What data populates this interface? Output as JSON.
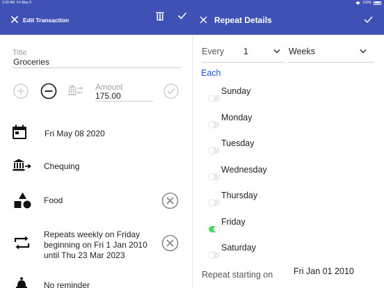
{
  "status_bar": {
    "time": "2:09 AM",
    "date": "Fri May 8",
    "battery": "100%"
  },
  "edit_panel": {
    "title": "Edit Transaction",
    "title_field": {
      "label": "Title",
      "value": "Groceries"
    },
    "amount_field": {
      "label": "Amount",
      "value": "175.00"
    },
    "date": "Fri May 08 2020",
    "account": "Chequing",
    "category": "Food",
    "repeat": [
      "Repeats weekly on Friday",
      "beginning on Fri 1 Jan 2010",
      "until Thu 23 Mar 2023"
    ],
    "reminder": "No reminder"
  },
  "repeat_panel": {
    "title": "Repeat Details",
    "every_label": "Every",
    "every_value": "1",
    "unit_value": "Weeks",
    "each_label": "Each",
    "days": [
      {
        "name": "Sunday",
        "selected": false
      },
      {
        "name": "Monday",
        "selected": false
      },
      {
        "name": "Tuesday",
        "selected": false
      },
      {
        "name": "Wednesday",
        "selected": false
      },
      {
        "name": "Thursday",
        "selected": false
      },
      {
        "name": "Friday",
        "selected": true
      },
      {
        "name": "Saturday",
        "selected": false
      }
    ],
    "start_label": "Repeat starting on",
    "start_value": "Fri Jan 01 2010"
  },
  "colors": {
    "header": "#3f51b5",
    "link": "#2255dd",
    "toggle_on": "#4cd964"
  }
}
